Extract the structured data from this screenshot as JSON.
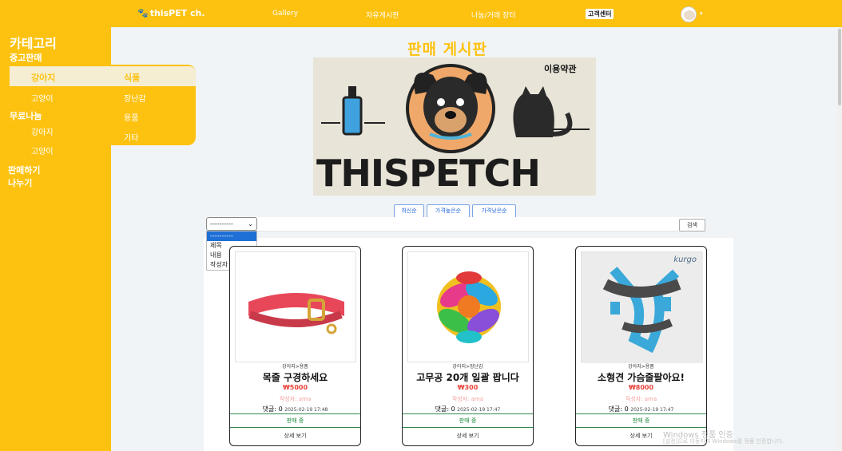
{
  "nav": {
    "brand": "thisPET ch.",
    "links": [
      "Gallery",
      "자유게시판",
      "나눔/거래 장터"
    ],
    "support": "고객센터"
  },
  "sidebar": {
    "title": "카테고리",
    "used_sale": "중고판매",
    "used_dog": "강아지",
    "used_cat": "고양이",
    "free_share": "무료나눔",
    "share_dog": "강아지",
    "share_cat": "고양이",
    "sell_action": "판매하기",
    "share_action": "나누기",
    "flyout": [
      "식품",
      "장난감",
      "용품",
      "기타"
    ]
  },
  "main": {
    "title": "판매 게시판",
    "banner_terms": "이용약관",
    "banner_logo_text": "THISPETCH",
    "sort_buttons": [
      "최신순",
      "가격높은순",
      "가격낮은순"
    ],
    "search_select_value": "----------",
    "dropdown_options": [
      "----------",
      "제목",
      "내용",
      "작성자"
    ],
    "search_button": "검색"
  },
  "cards": [
    {
      "category": "강아지>용품",
      "title": "목줄 구경하세요",
      "price": "₩5000",
      "author": "작성자: ama",
      "comments": "댓글: 0",
      "timestamp": "2025-02-19 17:48",
      "status": "판매 중",
      "detail": "상세 보기"
    },
    {
      "category": "강아지>장난감",
      "title": "고무공 20개 일괄 팝니다",
      "price": "₩300",
      "author": "작성자: ama",
      "comments": "댓글: 0",
      "timestamp": "2025-02-19 17:47",
      "status": "판매 중",
      "detail": "상세 보기"
    },
    {
      "category": "강아지>용품",
      "title": "소형견 가슴줄팔아요!",
      "price": "₩8000",
      "author": "작성자: ama",
      "comments": "댓글: 0",
      "timestamp": "2025-02-19 17:47",
      "status": "판매 중",
      "detail": "상세 보기"
    }
  ],
  "product_brand": "kurgo",
  "watermark": {
    "line1": "Windows 정품 인증",
    "line2": "[설정]으로 이동하여 Windows를 정품 인증합니다."
  },
  "colors": {
    "accent": "#fdc210",
    "price": "#e8453c",
    "link": "#2a6bd8",
    "status": "#1a8a3a"
  }
}
